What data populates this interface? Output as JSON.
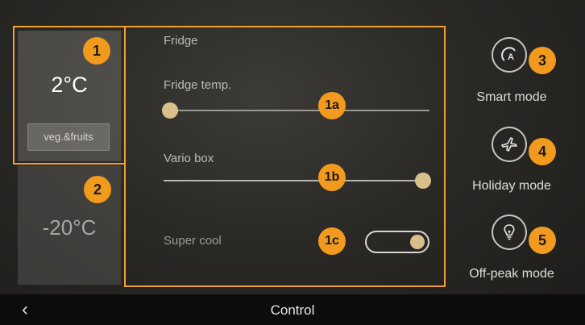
{
  "zones": {
    "fridge": {
      "temp": "2°C",
      "button": "veg.&fruits"
    },
    "freezer": {
      "temp": "-20°C"
    }
  },
  "fridge_panel": {
    "title": "Fridge",
    "temp_label": "Fridge temp.",
    "vario_label": "Vario box",
    "supercool_label": "Super cool",
    "temp_slider_level": 0.0,
    "vario_slider_level": 1.0,
    "supercool_on": true
  },
  "modes": [
    {
      "label": "Smart mode",
      "icon": "smart-mode-icon"
    },
    {
      "label": "Holiday mode",
      "icon": "airplane-icon"
    },
    {
      "label": "Off-peak mode",
      "icon": "lightbulb-icon"
    }
  ],
  "callouts": {
    "c1": "1",
    "c2": "2",
    "c3": "3",
    "c4": "4",
    "c5": "5",
    "c1a": "1a",
    "c1b": "1b",
    "c1c": "1c"
  },
  "bottom_bar": {
    "back": "‹",
    "title": "Control"
  },
  "colors": {
    "accent": "#f29a1e",
    "knob": "#d9c08a",
    "bar": "#0c0c0c"
  }
}
